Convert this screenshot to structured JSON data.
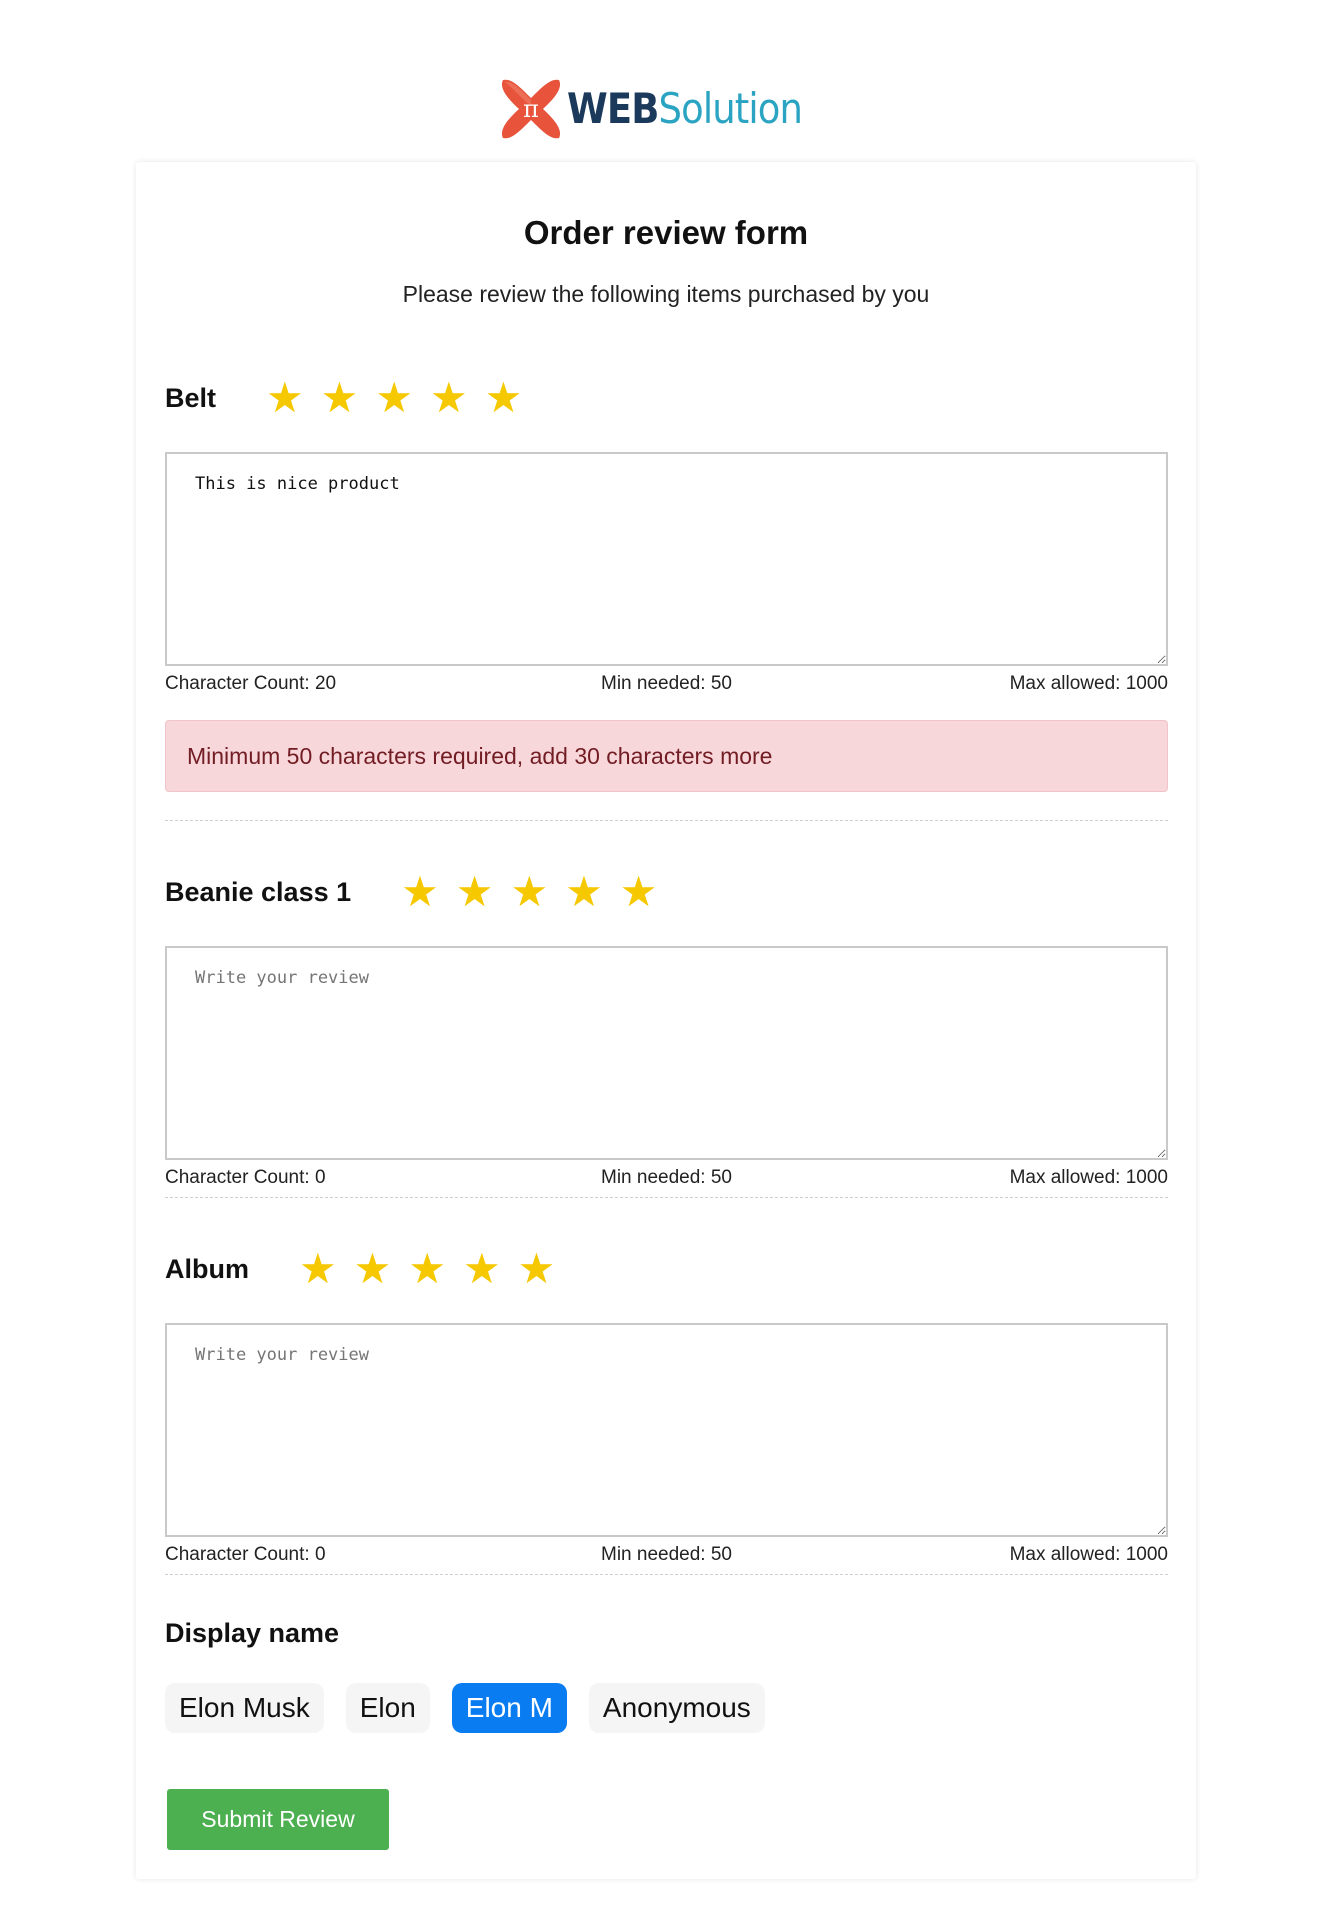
{
  "logo": {
    "text_primary": "WEB",
    "text_secondary": "Solution",
    "colors": {
      "mark": "#e8533b",
      "primary": "#1b3a5b",
      "secondary": "#2aa4c2"
    }
  },
  "form": {
    "title": "Order review form",
    "subtitle": "Please review the following items purchased by you"
  },
  "items": [
    {
      "name": "Belt",
      "review_value": "This is nice product",
      "placeholder": "Write your review",
      "char_count": "Character Count: 20",
      "min_needed": "Min needed: 50",
      "max_allowed": "Max allowed: 1000",
      "alert": "Minimum 50 characters required, add 30 characters more"
    },
    {
      "name": "Beanie class 1",
      "review_value": "",
      "placeholder": "Write your review",
      "char_count": "Character Count: 0",
      "min_needed": "Min needed: 50",
      "max_allowed": "Max allowed: 1000"
    },
    {
      "name": "Album",
      "review_value": "",
      "placeholder": "Write your review",
      "char_count": "Character Count: 0",
      "min_needed": "Min needed: 50",
      "max_allowed": "Max allowed: 1000"
    }
  ],
  "star_glyph": "★",
  "star_color": "#f5c800",
  "display_name": {
    "label": "Display name",
    "options": [
      "Elon Musk",
      "Elon",
      "Elon M",
      "Anonymous"
    ],
    "selected": "Elon M",
    "selected_color": "#0a7cf2"
  },
  "submit_label": "Submit Review",
  "submit_color": "#4caf50"
}
